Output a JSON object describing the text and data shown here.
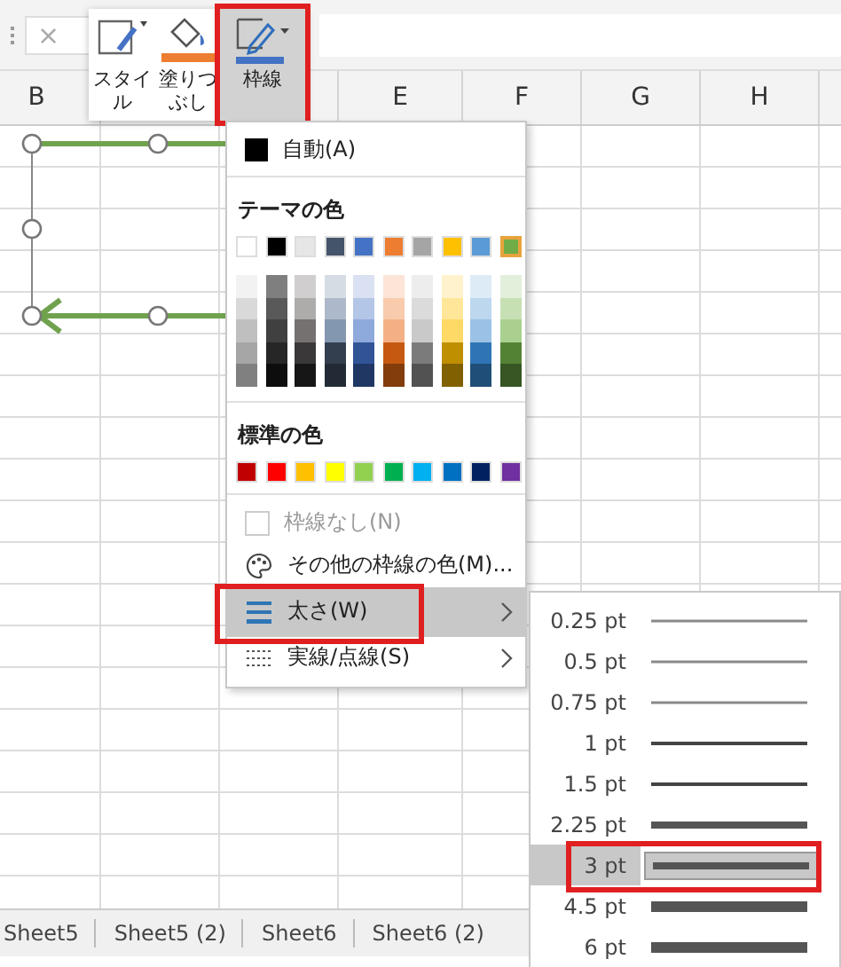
{
  "formula_bar": {
    "cancel": "×"
  },
  "columns": [
    {
      "label": "B"
    },
    {
      "label": "E"
    },
    {
      "label": "F"
    },
    {
      "label": "G"
    },
    {
      "label": "H"
    }
  ],
  "toolbar": {
    "buttons": [
      {
        "kind": "style",
        "label": "スタイル",
        "selected": false
      },
      {
        "kind": "fill",
        "label": "塗りつぶし",
        "selected": false
      },
      {
        "kind": "border",
        "label": "枠線",
        "selected": true
      }
    ]
  },
  "menu": {
    "auto": {
      "label": "自動(A)",
      "color": "#000000"
    },
    "theme_header": "テーマの色",
    "theme_colors": [
      {
        "color": "#ffffff",
        "selected": false,
        "shades": [
          {
            "color": "#f2f2f2"
          },
          {
            "color": "#d9d9d9"
          },
          {
            "color": "#bfbfbf"
          },
          {
            "color": "#a6a6a6"
          },
          {
            "color": "#808080"
          }
        ]
      },
      {
        "color": "#000000",
        "selected": false,
        "shades": [
          {
            "color": "#7f7f7f"
          },
          {
            "color": "#595959"
          },
          {
            "color": "#404040"
          },
          {
            "color": "#262626"
          },
          {
            "color": "#0d0d0d"
          }
        ]
      },
      {
        "color": "#e7e6e6",
        "selected": false,
        "shades": [
          {
            "color": "#d0cece"
          },
          {
            "color": "#aeabab"
          },
          {
            "color": "#757171"
          },
          {
            "color": "#3a3838"
          },
          {
            "color": "#171616"
          }
        ]
      },
      {
        "color": "#44546a",
        "selected": false,
        "shades": [
          {
            "color": "#d6dce4"
          },
          {
            "color": "#adb9ca"
          },
          {
            "color": "#8497b0"
          },
          {
            "color": "#333f4f"
          },
          {
            "color": "#222b35"
          }
        ]
      },
      {
        "color": "#4472c4",
        "selected": false,
        "shades": [
          {
            "color": "#d9e1f2"
          },
          {
            "color": "#b4c6e7"
          },
          {
            "color": "#8ea9db"
          },
          {
            "color": "#305496"
          },
          {
            "color": "#203764"
          }
        ]
      },
      {
        "color": "#ed7d31",
        "selected": false,
        "shades": [
          {
            "color": "#fce4d6"
          },
          {
            "color": "#f8cbad"
          },
          {
            "color": "#f4b084"
          },
          {
            "color": "#c65911"
          },
          {
            "color": "#833c0c"
          }
        ]
      },
      {
        "color": "#a5a5a5",
        "selected": false,
        "shades": [
          {
            "color": "#ededed"
          },
          {
            "color": "#dbdbdb"
          },
          {
            "color": "#c9c9c9"
          },
          {
            "color": "#7b7b7b"
          },
          {
            "color": "#525252"
          }
        ]
      },
      {
        "color": "#ffc000",
        "selected": false,
        "shades": [
          {
            "color": "#fff2cc"
          },
          {
            "color": "#ffe699"
          },
          {
            "color": "#ffd966"
          },
          {
            "color": "#bf8f00"
          },
          {
            "color": "#806000"
          }
        ]
      },
      {
        "color": "#5b9bd5",
        "selected": false,
        "shades": [
          {
            "color": "#ddebf7"
          },
          {
            "color": "#bdd7ee"
          },
          {
            "color": "#9bc2e6"
          },
          {
            "color": "#2f75b5"
          },
          {
            "color": "#1f4e78"
          }
        ]
      },
      {
        "color": "#70ad47",
        "selected": true,
        "shades": [
          {
            "color": "#e2efda"
          },
          {
            "color": "#c6e0b4"
          },
          {
            "color": "#a9d08e"
          },
          {
            "color": "#548235"
          },
          {
            "color": "#375623"
          }
        ]
      }
    ],
    "standard_header": "標準の色",
    "standard_colors": [
      {
        "color": "#c00000"
      },
      {
        "color": "#ff0000"
      },
      {
        "color": "#ffc000"
      },
      {
        "color": "#ffff00"
      },
      {
        "color": "#92d050"
      },
      {
        "color": "#00b050"
      },
      {
        "color": "#00b0f0"
      },
      {
        "color": "#0070c0"
      },
      {
        "color": "#002060"
      },
      {
        "color": "#7030a0"
      }
    ],
    "items": [
      {
        "kind": "none",
        "label": "枠線なし(N)",
        "disabled": true,
        "selected": false
      },
      {
        "kind": "palette",
        "label": "その他の枠線の色(M)...",
        "disabled": false,
        "selected": false
      },
      {
        "kind": "weight",
        "label": "太さ(W)",
        "disabled": false,
        "selected": true
      },
      {
        "kind": "dash",
        "label": "実線/点線(S)",
        "disabled": false,
        "selected": false
      }
    ]
  },
  "submenu": {
    "items": [
      {
        "label": "0.25 pt",
        "kind": "hairline",
        "selected": false
      },
      {
        "label": "0.5 pt",
        "kind": "hairline",
        "selected": false
      },
      {
        "label": "0.75 pt",
        "kind": "hairline",
        "selected": false
      },
      {
        "label": "1 pt",
        "kind": "thin",
        "selected": false
      },
      {
        "label": "1.5 pt",
        "kind": "thin",
        "selected": false
      },
      {
        "label": "2.25 pt",
        "kind": "medium",
        "selected": false
      },
      {
        "label": "3 pt",
        "kind": "medium",
        "selected": true
      },
      {
        "label": "4.5 pt",
        "kind": "thick",
        "selected": false
      },
      {
        "label": "6 pt",
        "kind": "thick",
        "selected": false
      }
    ]
  },
  "sheet_tabs": [
    {
      "label": "Sheet5"
    },
    {
      "label": "Sheet5 (2)"
    },
    {
      "label": "Sheet6"
    },
    {
      "label": "Sheet6 (2)"
    }
  ]
}
